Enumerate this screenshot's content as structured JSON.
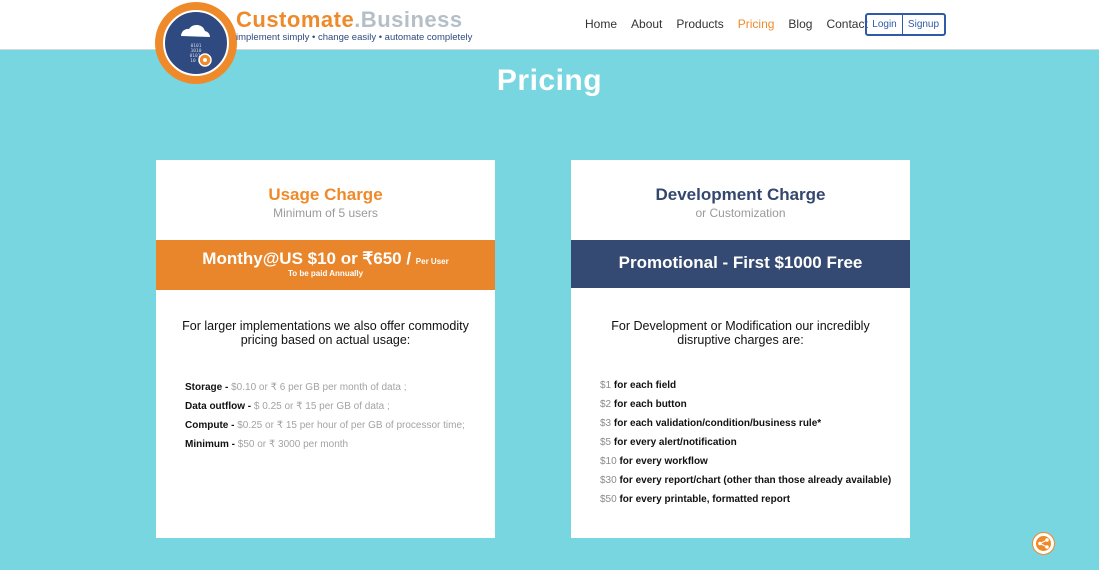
{
  "brand": {
    "name_part1": "Customate",
    "name_part2": ".Business",
    "tagline": "implement simply • change easily • automate completely",
    "logo_icon": "cloud-gear-logo",
    "logo_digits": [
      "0101",
      "1010",
      "0101",
      "10"
    ]
  },
  "nav": {
    "items": [
      {
        "label": "Home"
      },
      {
        "label": "About"
      },
      {
        "label": "Products"
      },
      {
        "label": "Pricing",
        "active": true
      },
      {
        "label": "Blog"
      },
      {
        "label": "Contact"
      }
    ],
    "login_label": "Login",
    "signup_label": "Signup"
  },
  "page": {
    "title": "Pricing"
  },
  "usage_card": {
    "title": "Usage Charge",
    "subtitle": "Minimum of 5 users",
    "price_main": "Monthy@US $10 or ₹650 / ",
    "price_unit": "Per User",
    "price_note": "To be paid Annually",
    "intro": "For larger implementations we also offer commodity pricing based on actual usage:",
    "items": [
      {
        "label": "Storage - ",
        "value": "$0.10 or ₹ 6 per GB per month of data ;"
      },
      {
        "label": "Data outflow - ",
        "value": "$ 0.25 or ₹ 15 per GB of data ;"
      },
      {
        "label": "Compute - ",
        "value": "$0.25 or ₹ 15 per hour of per GB of processor time;"
      },
      {
        "label": "Minimum - ",
        "value": "$50 or ₹ 3000 per month"
      }
    ]
  },
  "dev_card": {
    "title": "Development Charge",
    "subtitle": "or Customization",
    "promo": "Promotional - First $1000 Free",
    "intro": "For Development or Modification our incredibly disruptive charges are:",
    "items": [
      {
        "amount": "$1",
        "desc": " for each field"
      },
      {
        "amount": "$2",
        "desc": " for each button"
      },
      {
        "amount": "$3",
        "desc": " for each validation/condition/business rule*"
      },
      {
        "amount": "$5",
        "desc": " for every alert/notification"
      },
      {
        "amount": "$10",
        "desc": " for every workflow"
      },
      {
        "amount": "$30",
        "desc": " for every report/chart (other than those already available)"
      },
      {
        "amount": "$50",
        "desc": " for every printable, formatted report"
      }
    ]
  },
  "share": {
    "icon": "share-icon"
  },
  "colors": {
    "background": "#78d6e1",
    "accent_orange": "#ef8a2a",
    "navy": "#354a72"
  }
}
